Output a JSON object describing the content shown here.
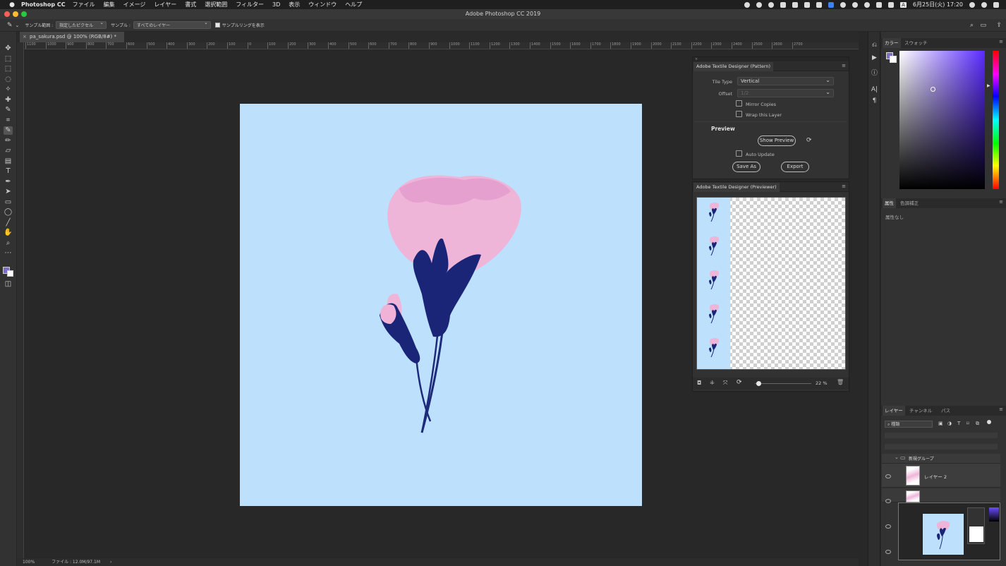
{
  "menubar": {
    "app_name": "Photoshop CC",
    "items": [
      "ファイル",
      "編集",
      "イメージ",
      "レイヤー",
      "書式",
      "選択範囲",
      "フィルター",
      "3D",
      "表示",
      "ウィンドウ",
      "ヘルプ"
    ],
    "clock": "6月25日(火) 17:20",
    "input_method": "A"
  },
  "window": {
    "title": "Adobe Photoshop CC 2019"
  },
  "options_bar": {
    "sample_size_label": "サンプル範囲 :",
    "sample_size_value": "指定したピクセル",
    "sample_label": "サンプル :",
    "sample_value": "すべてのレイヤー",
    "sampling_ring_label": "サンプルリングを表示"
  },
  "document": {
    "tab_label": "pa_sakura.psd @ 100% (RGB/8#) *",
    "canvas_color": "#bde0fd"
  },
  "ruler": {
    "ticks": [
      "1100",
      "1000",
      "900",
      "800",
      "700",
      "600",
      "500",
      "400",
      "300",
      "200",
      "100",
      "0",
      "100",
      "200",
      "300",
      "400",
      "500",
      "600",
      "700",
      "800",
      "900",
      "1000",
      "1100",
      "1200",
      "1300",
      "1400",
      "1500",
      "1600",
      "1700",
      "1800",
      "1900",
      "2000",
      "2100",
      "2200",
      "2300",
      "2400",
      "2500",
      "2600",
      "2700"
    ]
  },
  "status": {
    "zoom": "100%",
    "file_info": "ファイル : 12.0M/97.1M"
  },
  "pattern_panel": {
    "title": "Adobe Textile Designer (Pattern)",
    "tile_type_label": "Tile Type",
    "tile_type_value": "Vertical",
    "offset_label": "Offset",
    "offset_value": "1/2",
    "mirror_copies_label": "Mirror Copies",
    "wrap_layer_label": "Wrap this Layer",
    "preview_heading": "Preview",
    "show_preview_label": "Show Preview",
    "auto_update_label": "Auto Update",
    "save_as_label": "Save As",
    "export_label": "Export"
  },
  "previewer_panel": {
    "title": "Adobe Textile Designer (Previewer)",
    "zoom_value": "22 %",
    "zoom_fraction": 0.02
  },
  "color_panel": {
    "tabs": [
      "カラー",
      "スウォッチ"
    ],
    "foreground_color": "#7b6fc4",
    "background_color": "#ffffff"
  },
  "properties_panel": {
    "tabs": [
      "属性",
      "色調補正"
    ],
    "empty_text": "属性なし"
  },
  "layers_panel": {
    "tabs": [
      "レイヤー",
      "チャンネル",
      "パス"
    ],
    "filter_label": "種類",
    "group_name": "新規グループ",
    "layers": [
      "レイヤー 2"
    ]
  }
}
